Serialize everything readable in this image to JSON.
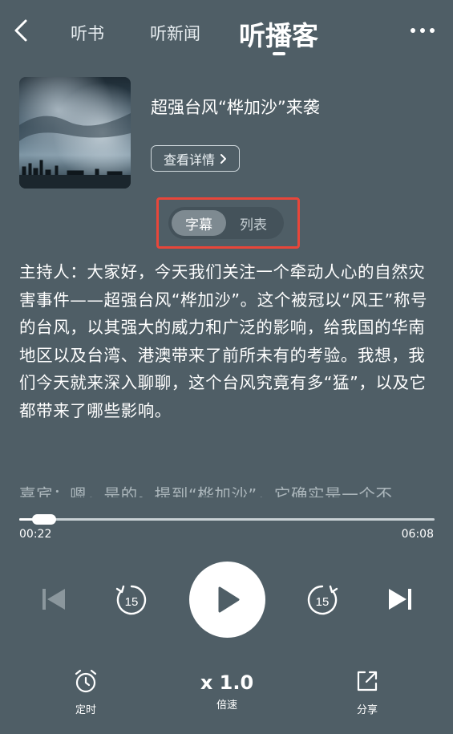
{
  "header": {
    "tabs": [
      {
        "label": "听书"
      },
      {
        "label": "听新闻"
      },
      {
        "label": "听播客"
      }
    ]
  },
  "episode": {
    "title": "超强台风“桦加沙”来袭",
    "detail_button": "查看详情"
  },
  "view_toggle": {
    "options": [
      {
        "label": "字幕"
      },
      {
        "label": "列表"
      }
    ],
    "selected": "字幕"
  },
  "transcript": {
    "current": "主持人：大家好，今天我们关注一个牵动人心的自然灾害事件——超强台风“桦加沙”。这个被冠以“风王”称号的台风，以其强大的威力和广泛的影响，给我国的华南地区以及台湾、港澳带来了前所未有的考验。我想，我们今天就来深入聊聊，这个台风究竟有多“猛”，以及它都带来了哪些影响。",
    "next": "嘉宾：嗯，是的。提到“桦加沙”，它确实是一个不"
  },
  "player": {
    "current_time": "00:22",
    "total_time": "06:08",
    "progress": 0.06,
    "rewind_seconds": "15",
    "forward_seconds": "15"
  },
  "actions": {
    "timer_label": "定时",
    "speed_value": "x 1.0",
    "speed_label": "倍速",
    "share_label": "分享"
  },
  "colors": {
    "background": "#4f5e66",
    "highlight_box": "#e8463a"
  }
}
